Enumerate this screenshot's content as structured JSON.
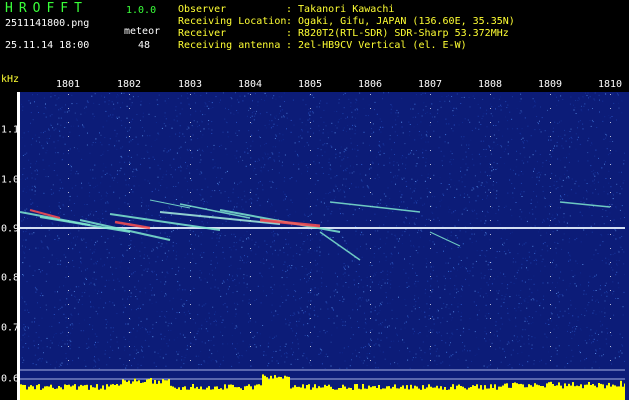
{
  "app": {
    "name": "HROFFT",
    "version": "1.0.0"
  },
  "file": {
    "name": "2511141800.png",
    "datetime": "25.11.14 18:00"
  },
  "meteor": {
    "label": "meteor",
    "count": "48"
  },
  "info": [
    {
      "label": "Observer",
      "value": ": Takanori Kawachi"
    },
    {
      "label": "Receiving Location",
      "value": ": Ogaki, Gifu, JAPAN (136.60E, 35.35N)"
    },
    {
      "label": "Receiver",
      "value": ": R820T2(RTL-SDR) SDR-Sharp 53.372MHz"
    },
    {
      "label": "Receiving antenna",
      "value": ": 2el-HB9CV Vertical (el. E-W)"
    }
  ],
  "axis": {
    "y_unit": "kHz",
    "x_ticks": [
      "1801",
      "1802",
      "1803",
      "1804",
      "1805",
      "1806",
      "1807",
      "1808",
      "1809",
      "1810"
    ],
    "y_ticks": [
      "1.1",
      "1.0",
      "0.9",
      "0.8",
      "0.7",
      "0.6"
    ]
  },
  "colors": {
    "background": "#0c1c78",
    "carrier": "#e8f4ff",
    "echo": "#7fe8d0",
    "strong": "#ff4444",
    "level": "#ffff00"
  }
}
